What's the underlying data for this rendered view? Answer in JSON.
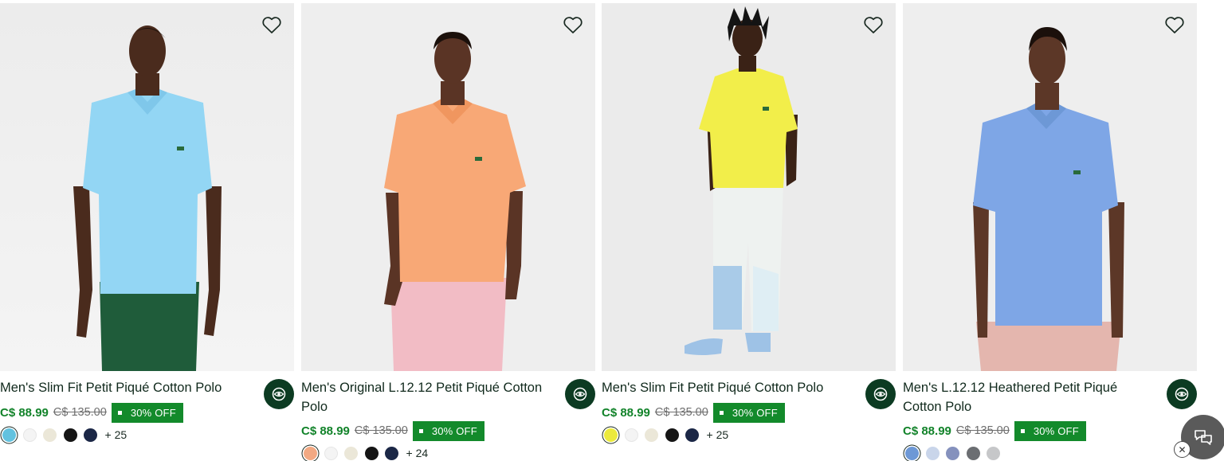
{
  "accent": "#0c3b22",
  "price_color": "#12832a",
  "badge_color": "#138a2b",
  "products": [
    {
      "title": "Men's Slim Fit Petit Piqué Cotton Polo",
      "price": "C$ 88.99",
      "old_price": "C$ 135.00",
      "discount": "30% OFF",
      "swatches": [
        "#62c2df",
        "#f4f4f4",
        "#ebe7d8",
        "#151515",
        "#1b2746"
      ],
      "more_colors": "+ 25"
    },
    {
      "title": "Men's Original L.12.12 Petit Piqué Cotton Polo",
      "price": "C$ 88.99",
      "old_price": "C$ 135.00",
      "discount": "30% OFF",
      "swatches": [
        "#f2a983",
        "#f4f4f4",
        "#ebe7d8",
        "#151515",
        "#1b2746"
      ],
      "more_colors": "+ 24"
    },
    {
      "title": "Men's Slim Fit Petit Piqué Cotton Polo",
      "price": "C$ 88.99",
      "old_price": "C$ 135.00",
      "discount": "30% OFF",
      "swatches": [
        "#ecea3d",
        "#f4f4f4",
        "#ebe7d8",
        "#151515",
        "#1b2746"
      ],
      "more_colors": "+ 25"
    },
    {
      "title": "Men's L.12.12 Heathered Petit Piqué Cotton Polo",
      "price": "C$ 88.99",
      "old_price": "C$ 135.00",
      "discount": "30% OFF",
      "swatches": [
        "#6d98d6",
        "#c9d5ea",
        "#8591bd",
        "#6b6e72",
        "#c6c7c9"
      ],
      "more_colors": ""
    }
  ],
  "icons": {
    "wishlist": "heart-outline-icon",
    "quick_view": "eye-icon",
    "chat": "chat-bubbles-icon",
    "close": "close-icon"
  }
}
